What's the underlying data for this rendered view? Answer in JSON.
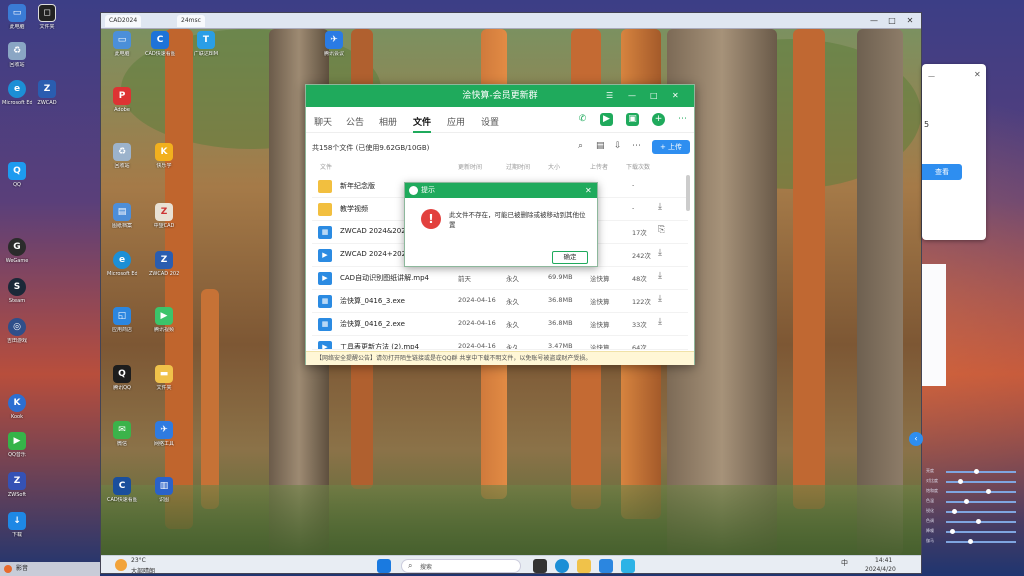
{
  "outer_desktop": {
    "icons": [
      "此电脑",
      "文件夹",
      "回收站",
      "Microsoft Edge",
      "ZWCAD",
      "QQ",
      "WeGame",
      "Steam",
      "吉田游戏",
      "Kook",
      "QQ音乐",
      "ZWSoft",
      "下载"
    ],
    "taskbar_label": "影音"
  },
  "vm": {
    "tabs": [
      "CAD2024",
      "24msc"
    ],
    "controls": [
      "—",
      "□",
      "✕"
    ]
  },
  "inner_desktop": {
    "icons": [
      "此电脑",
      "CAD快速看图",
      "广联达BIM",
      "腾讯会议",
      "Adobe",
      "回收站",
      "快乐学",
      "图纸档案",
      "中望CAD",
      "Microsoft Edge",
      "ZWCAD 2024",
      "应用商店",
      "腾讯视频",
      "腾讯QQ",
      "文件夹",
      "微信",
      "网络工具",
      "CAD快速看图",
      "识图"
    ]
  },
  "qq_window": {
    "title": "浍快算-会员更新群",
    "header_controls": [
      "☰",
      "—",
      "□",
      "✕"
    ],
    "tabs": [
      "聊天",
      "公告",
      "相册",
      "文件",
      "应用",
      "设置"
    ],
    "active_tab": "文件",
    "summary": "共158个文件 (已使用9.62GB/10GB)",
    "upload_label": "+ 上传",
    "columns": [
      "文件",
      "更新时间",
      "过期时间",
      "大小",
      "上传者",
      "下载次数"
    ],
    "rows": [
      {
        "icon": "folder",
        "name": "新年纪念版",
        "date": "",
        "expire": "",
        "size": "",
        "uploader": "",
        "downloads": "-"
      },
      {
        "icon": "folder",
        "name": "教学视频",
        "date": "",
        "expire": "",
        "size": "",
        "uploader": "",
        "downloads": "-"
      },
      {
        "icon": "exe",
        "name": "ZWCAD 2024&2025",
        "date": "",
        "expire": "",
        "size": "",
        "uploader": "",
        "downloads": "17次"
      },
      {
        "icon": "video",
        "name": "ZWCAD 2024+2025",
        "date": "",
        "expire": "",
        "size": "",
        "uploader": "",
        "downloads": "242次"
      },
      {
        "icon": "video",
        "name": "CAD自动识别图纸讲解.mp4",
        "date": "前天",
        "expire": "永久",
        "size": "69.9MB",
        "uploader": "浍快算",
        "downloads": "48次"
      },
      {
        "icon": "exe",
        "name": "浍快算_0416_3.exe",
        "date": "2024-04-16",
        "expire": "永久",
        "size": "36.8MB",
        "uploader": "浍快算",
        "downloads": "122次"
      },
      {
        "icon": "exe",
        "name": "浍快算_0416_2.exe",
        "date": "2024-04-16",
        "expire": "永久",
        "size": "36.8MB",
        "uploader": "浍快算",
        "downloads": "33次"
      },
      {
        "icon": "video",
        "name": "工具表更新方法 (2).mp4",
        "date": "2024-04-16",
        "expire": "永久",
        "size": "3.47MB",
        "uploader": "浍快算",
        "downloads": "64次"
      }
    ],
    "notice": "【网络安全提醒公告】请勿打开陌生链接或是在QQ群 共享中下载不明文件，以免账号被盗或财产受损。"
  },
  "alert": {
    "title": "提示",
    "message": "此文件不存在，可能已被删除或被移动到其他位置",
    "ok_label": "确定"
  },
  "right_panel": {
    "ok_label": "查看",
    "count": "5",
    "sliders": [
      "亮度",
      "对比度",
      "饱和度",
      "色温",
      "锐化",
      "色调",
      "降噪",
      "伽马"
    ]
  },
  "inner_taskbar": {
    "weather_temp": "23°C",
    "weather_desc": "大部晴朗",
    "search_placeholder": "搜索",
    "tray_lang": "中",
    "time": "14:41",
    "date": "2024/4/20"
  },
  "colors": {
    "qq_green": "#1faa5c",
    "accent_blue": "#2e8ef0",
    "error_red": "#e2413e"
  }
}
